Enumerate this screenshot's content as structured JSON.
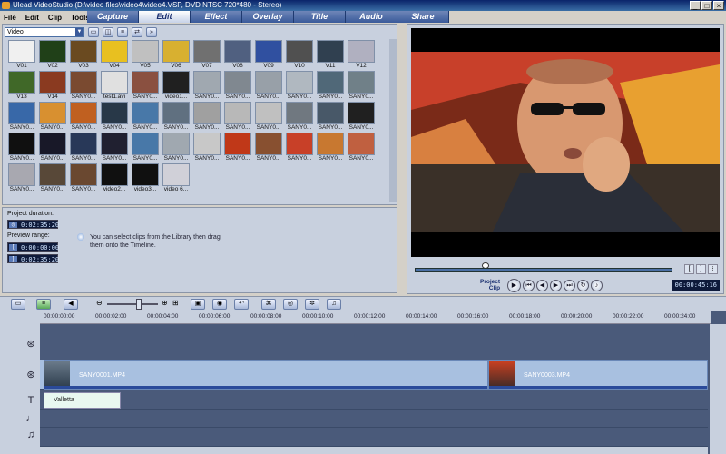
{
  "window": {
    "title": "Ulead VideoStudio (D:\\video files\\video4\\video4.VSP, DVD NTSC 720*480 - Stereo)"
  },
  "menu": [
    "File",
    "Edit",
    "Clip",
    "Tools"
  ],
  "steps": [
    "Capture",
    "Edit",
    "Effect",
    "Overlay",
    "Title",
    "Audio",
    "Share"
  ],
  "active_step": "Edit",
  "library": {
    "dropdown_value": "Video",
    "clips": [
      "V01",
      "V02",
      "V03",
      "V04",
      "V05",
      "V06",
      "V07",
      "V08",
      "V09",
      "V10",
      "V11",
      "V12",
      "V13",
      "V14",
      "SANY0...",
      "test1.avi",
      "SANY0...",
      "video1...",
      "SANY0...",
      "SANY0...",
      "SANY0...",
      "SANY0...",
      "SANY0...",
      "SANY0...",
      "SANY0...",
      "SANY0...",
      "SANY0...",
      "SANY0...",
      "SANY0...",
      "SANY0...",
      "SANY0...",
      "SANY0...",
      "SANY0...",
      "SANY0...",
      "SANY0...",
      "SANY0...",
      "SANY0...",
      "SANY0...",
      "SANY0...",
      "SANY0...",
      "SANY0...",
      "SANY0...",
      "SANY0...",
      "SANY0...",
      "SANY0...",
      "SANY0...",
      "SANY0...",
      "SANY0...",
      "SANY0...",
      "SANY0...",
      "SANY0...",
      "video2...",
      "video3...",
      "video 6..."
    ]
  },
  "info": {
    "project_duration_label": "Project duration:",
    "project_duration": "0:02:35:20",
    "preview_range_label": "Preview range:",
    "range_start": "0:00:00:00",
    "range_end": "0:02:35:20",
    "tip": "You can select clips from the Library then drag them onto the Timeline."
  },
  "preview": {
    "project_label": "Project",
    "clip_label": "Clip",
    "timecode": "00:00:45:16"
  },
  "timeline": {
    "ruler": [
      "00:00:00:00",
      "00:00:02:00",
      "00:00:04:00",
      "00:00:06:00",
      "00:00:08:00",
      "00:00:10:00",
      "00:00:12:00",
      "00:00:14:00",
      "00:00:16:00",
      "00:00:18:00",
      "00:00:20:00",
      "00:00:22:00",
      "00:00:24:00"
    ],
    "clip1": "SANY0001.MP4",
    "clip2": "SANY0003.MP4",
    "title_clip": "Valletta"
  }
}
